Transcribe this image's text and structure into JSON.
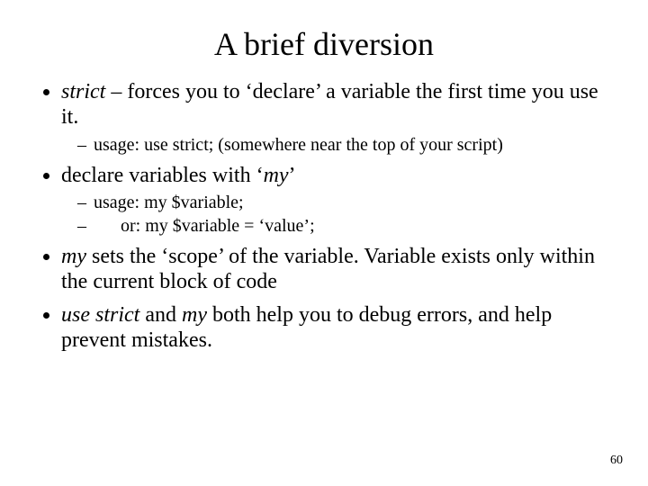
{
  "title": "A brief diversion",
  "b1": {
    "pre": "strict",
    "post": " – forces you to ‘declare’ a variable the first time you use it.",
    "sub1": "usage:  use strict;  (somewhere near the top of your script)"
  },
  "b2": {
    "pre": "declare variables with ‘",
    "it": "my",
    "post": "’",
    "sub1": "usage:  my $variable;",
    "sub2": "      or:  my $variable = ‘value’;"
  },
  "b3": {
    "it": "my",
    "post": " sets the ‘scope’ of the variable.  Variable exists only within the current block of code"
  },
  "b4": {
    "it1": "use strict",
    "mid": " and ",
    "it2": "my",
    "post": " both help you to debug errors, and help prevent mistakes."
  },
  "page_num": "60"
}
